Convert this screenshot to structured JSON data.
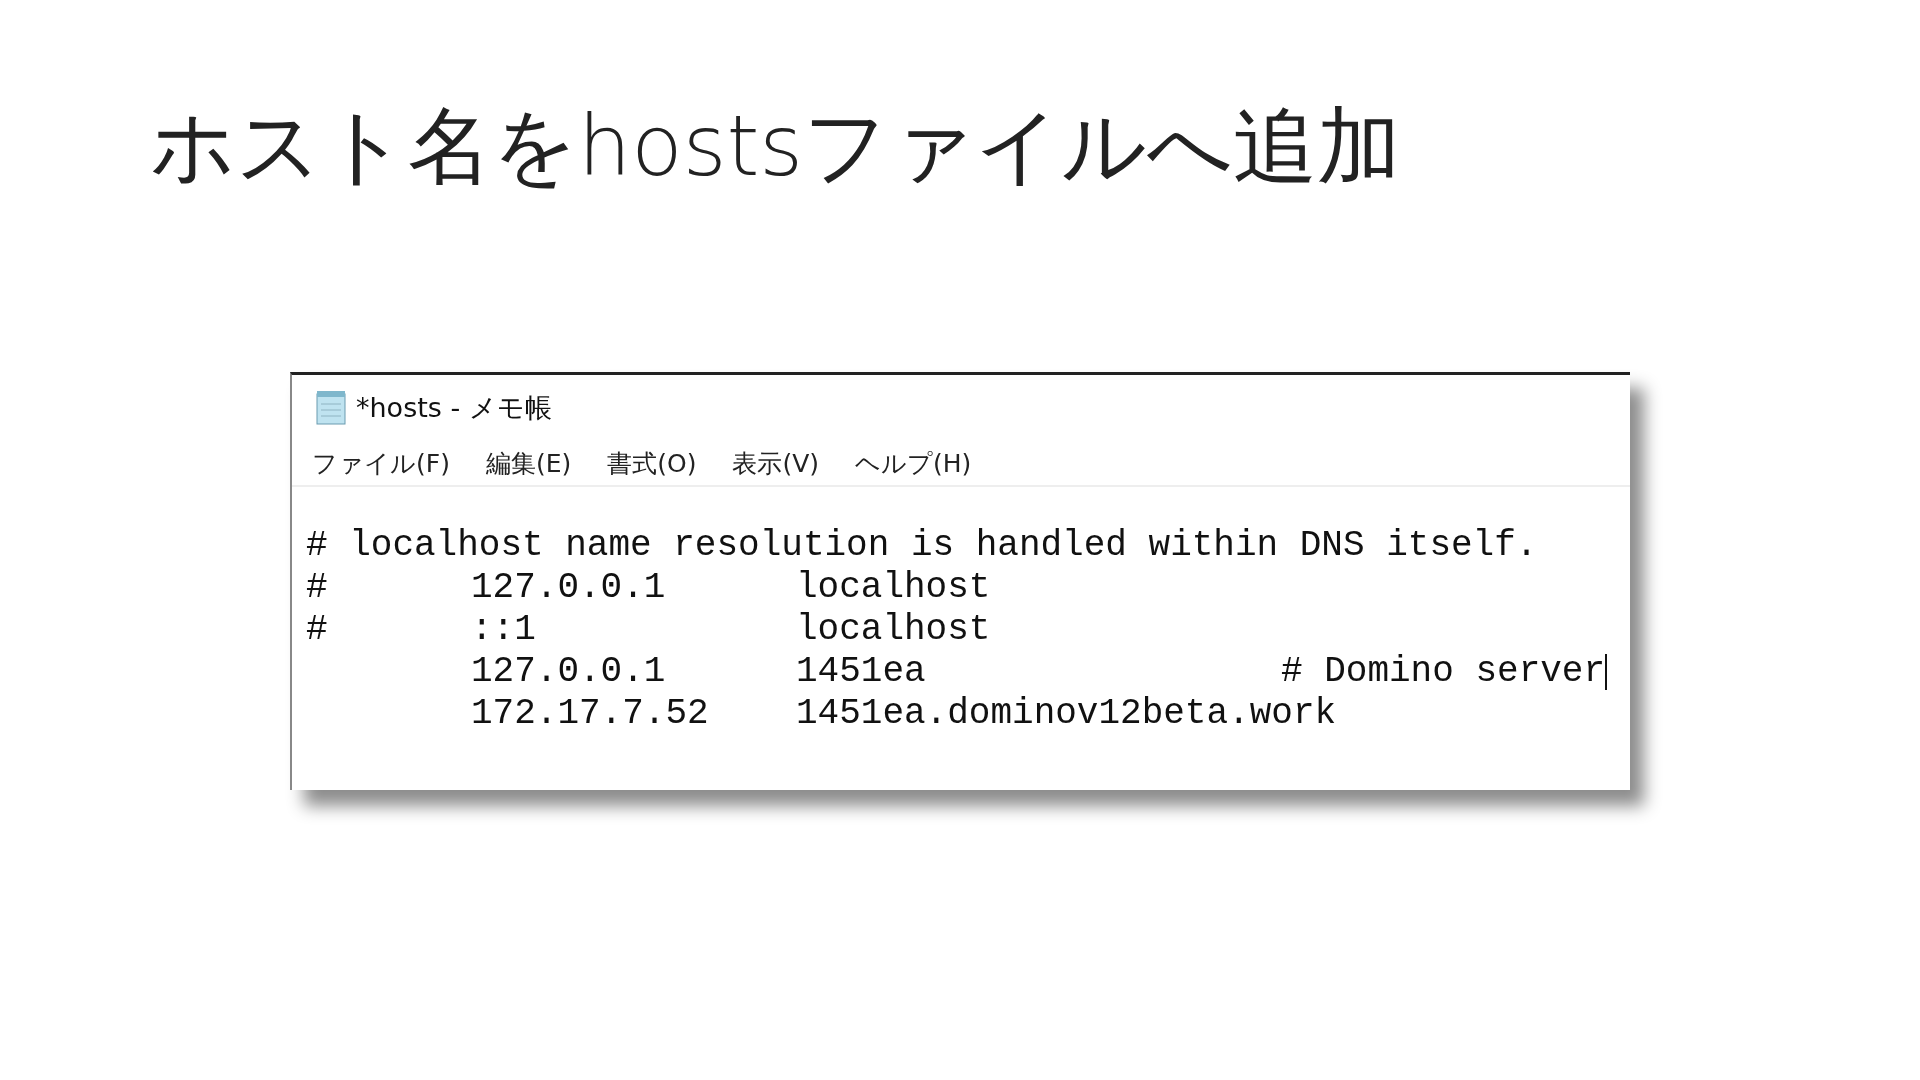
{
  "slide": {
    "title": "ホスト名をhostsファイルへ追加"
  },
  "window": {
    "title": "*hosts - メモ帳",
    "menu": [
      "ファイル(F)",
      "編集(E)",
      "書式(O)",
      "表示(V)",
      "ヘルプ(H)"
    ],
    "lines": [
      {
        "kind": "comment",
        "text": "# localhost name resolution is handled within DNS itself.",
        "caret": false
      },
      {
        "kind": "entry",
        "mark": "#",
        "address": "127.0.0.1",
        "host": "localhost",
        "caret": false
      },
      {
        "kind": "entry",
        "mark": "#",
        "address": "::1",
        "host": "localhost",
        "caret": false
      },
      {
        "kind": "entry",
        "address": "127.0.0.1",
        "host": "1451ea",
        "comment": "# Domino server",
        "caret": true
      },
      {
        "kind": "entry",
        "address": "172.17.7.52",
        "host": "1451ea.dominov12beta.work",
        "caret": false
      }
    ]
  }
}
